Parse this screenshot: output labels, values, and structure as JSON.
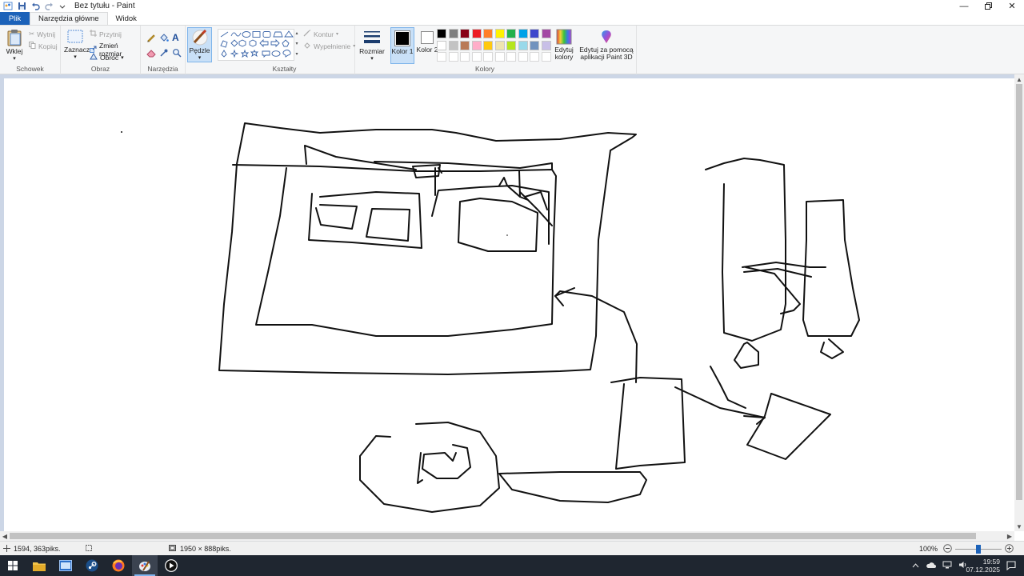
{
  "window": {
    "title": "Bez tytułu - Paint"
  },
  "tabs": [
    {
      "label": "Plik"
    },
    {
      "label": "Narzędzia główne"
    },
    {
      "label": "Widok"
    }
  ],
  "ribbon": {
    "clipboard": {
      "label": "Schowek",
      "paste": "Wklej",
      "cut": "Wytnij",
      "copy": "Kopiuj"
    },
    "image": {
      "label": "Obraz",
      "select": "Zaznacz",
      "crop": "Przytnij",
      "resize": "Zmień rozmiar",
      "rotate": "Obróć"
    },
    "tools": {
      "label": "Narzędzia"
    },
    "brushes": {
      "label": "Pędzle"
    },
    "shapes": {
      "label": "Kształty",
      "outline": "Kontur",
      "fill": "Wypełnienie"
    },
    "size": {
      "label": "Rozmiar"
    },
    "colors": {
      "label": "Kolory",
      "color1": "Kolor 1",
      "color2": "Kolor 2",
      "edit": "Edytuj kolory",
      "paint3d": "Edytuj za pomocą aplikacji Paint 3D",
      "color1_value": "#000000",
      "color2_value": "#ffffff",
      "palette_row1": [
        "#000000",
        "#7f7f7f",
        "#880015",
        "#ed1c24",
        "#ff7f27",
        "#fff200",
        "#22b14c",
        "#00a2e8",
        "#3f48cc",
        "#a349a4"
      ],
      "palette_row2": [
        "#ffffff",
        "#c3c3c3",
        "#b97a57",
        "#ffaec9",
        "#ffc90e",
        "#efe4b0",
        "#b5e61d",
        "#99d9ea",
        "#7092be",
        "#c8bfe7"
      ]
    }
  },
  "status": {
    "cursor_pos": "1594, 363piks.",
    "canvas_size": "1950 × 888piks.",
    "zoom": "100%",
    "zoom_level": 0.5
  },
  "taskbar": {
    "time": "19:59",
    "date": "07.12.2025"
  }
}
